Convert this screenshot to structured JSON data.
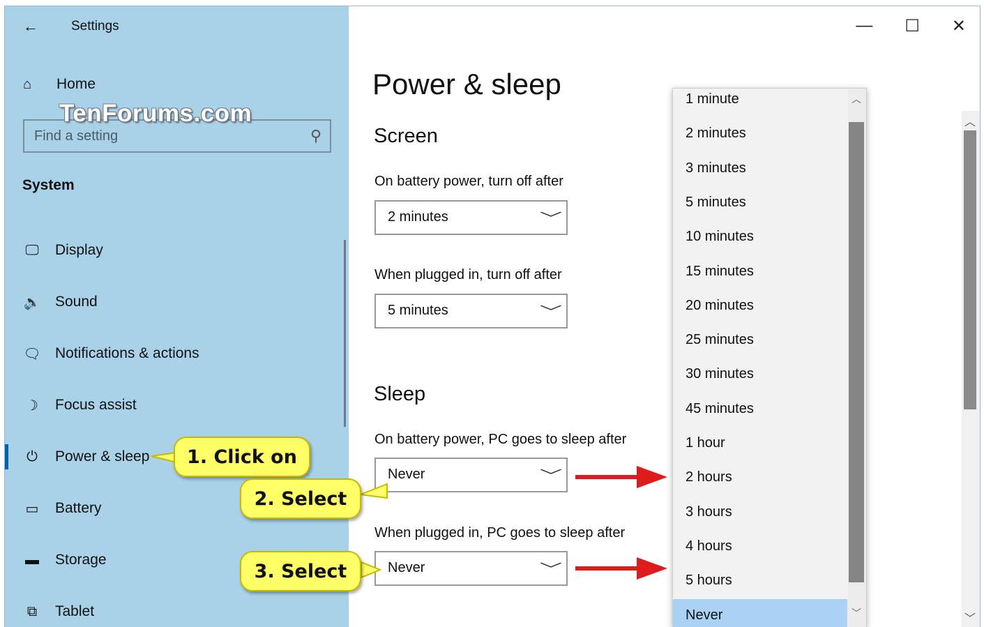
{
  "window": {
    "app_title": "Settings",
    "back_glyph": "←",
    "minimize_glyph": "—",
    "maximize_glyph": "☐",
    "close_glyph": "✕"
  },
  "watermark": "TenForums.com",
  "sidebar": {
    "home_label": "Home",
    "home_icon": "⌂",
    "search_placeholder": "Find a setting",
    "search_icon": "⚲",
    "section_label": "System",
    "items": [
      {
        "label": "Display",
        "icon": "🖵",
        "icon_name": "display-icon"
      },
      {
        "label": "Sound",
        "icon": "🔈",
        "icon_name": "sound-icon"
      },
      {
        "label": "Notifications & actions",
        "icon": "🗨",
        "icon_name": "notifications-icon"
      },
      {
        "label": "Focus assist",
        "icon": "☽",
        "icon_name": "focus-assist-icon"
      },
      {
        "label": "Power & sleep",
        "icon": "⏻",
        "icon_name": "power-icon"
      },
      {
        "label": "Battery",
        "icon": "▭",
        "icon_name": "battery-icon"
      },
      {
        "label": "Storage",
        "icon": "▬",
        "icon_name": "storage-icon"
      },
      {
        "label": "Tablet",
        "icon": "⧉",
        "icon_name": "tablet-icon"
      }
    ]
  },
  "main": {
    "page_title": "Power & sleep",
    "screen_heading": "Screen",
    "screen_battery_label": "On battery power, turn off after",
    "screen_battery_value": "2 minutes",
    "screen_plugged_label": "When plugged in, turn off after",
    "screen_plugged_value": "5 minutes",
    "sleep_heading": "Sleep",
    "sleep_battery_label": "On battery power, PC goes to sleep after",
    "sleep_battery_value": "Never",
    "sleep_plugged_label": "When plugged in, PC goes to sleep after",
    "sleep_plugged_value": "Never",
    "chevron": "﹀"
  },
  "dropdown": {
    "options": [
      "1 minute",
      "2 minutes",
      "3 minutes",
      "5 minutes",
      "10 minutes",
      "15 minutes",
      "20 minutes",
      "25 minutes",
      "30 minutes",
      "45 minutes",
      "1 hour",
      "2 hours",
      "3 hours",
      "4 hours",
      "5 hours",
      "Never"
    ],
    "selected": "Never",
    "selected_color": "#a9d2f5"
  },
  "callouts": {
    "step1": "1. Click on",
    "step2": "2. Select",
    "step3": "3. Select"
  },
  "colors": {
    "sidebar_bg": "#a9d2e9",
    "accent": "#0063b1",
    "arrow": "#e01b1b",
    "callout_bg": "#ffff66"
  }
}
